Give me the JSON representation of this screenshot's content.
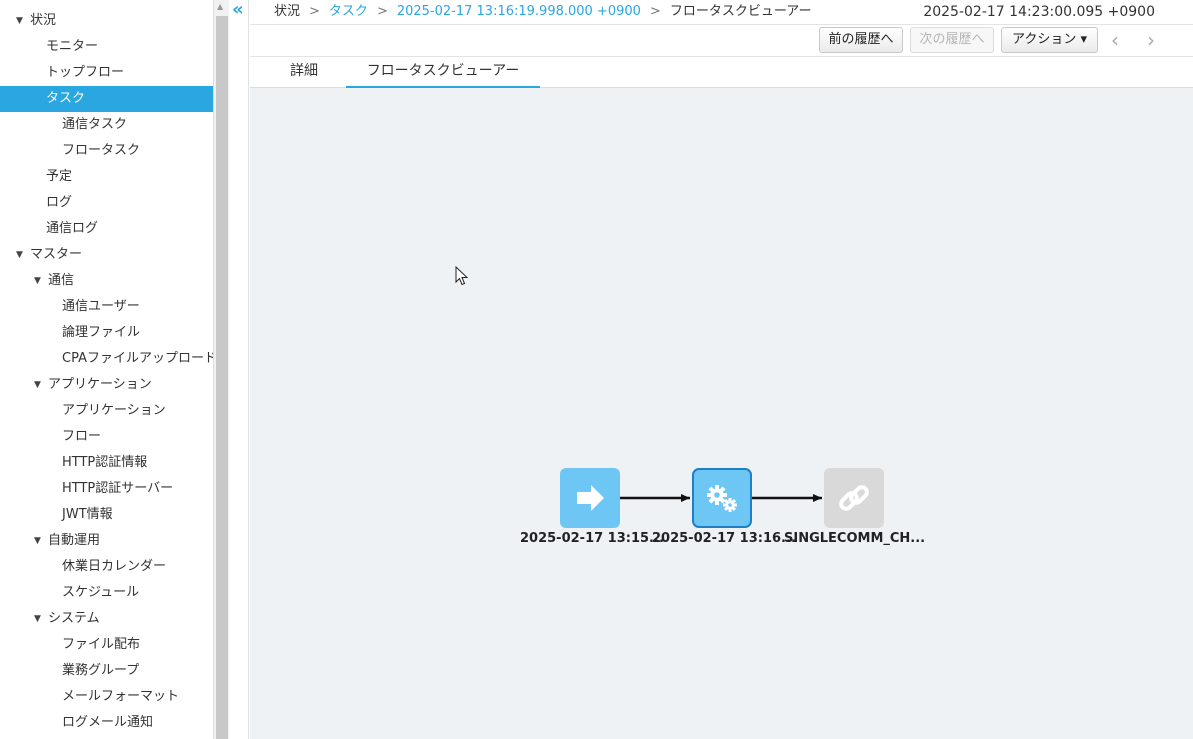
{
  "sidebar": {
    "items": [
      {
        "label": "状況",
        "caret": "▼"
      },
      {
        "label": "モニター"
      },
      {
        "label": "トップフロー"
      },
      {
        "label": "タスク",
        "selected": true
      },
      {
        "label": "通信タスク"
      },
      {
        "label": "フロータスク"
      },
      {
        "label": "予定"
      },
      {
        "label": "ログ"
      },
      {
        "label": "通信ログ"
      },
      {
        "label": "マスター",
        "caret": "▼"
      },
      {
        "label": "通信",
        "caret": "▼"
      },
      {
        "label": "通信ユーザー"
      },
      {
        "label": "論理ファイル"
      },
      {
        "label": "CPAファイルアップロード"
      },
      {
        "label": "アプリケーション",
        "caret": "▼"
      },
      {
        "label": "アプリケーション"
      },
      {
        "label": "フロー"
      },
      {
        "label": "HTTP認証情報"
      },
      {
        "label": "HTTP認証サーバー"
      },
      {
        "label": "JWT情報"
      },
      {
        "label": "自動運用",
        "caret": "▼"
      },
      {
        "label": "休業日カレンダー"
      },
      {
        "label": "スケジュール"
      },
      {
        "label": "システム",
        "caret": "▼"
      },
      {
        "label": "ファイル配布"
      },
      {
        "label": "業務グループ"
      },
      {
        "label": "メールフォーマット"
      },
      {
        "label": "ログメール通知"
      }
    ],
    "collapse_glyph": "«"
  },
  "breadcrumb": {
    "items": [
      "状況",
      "タスク",
      "2025-02-17 13:16:19.998.000 +0900",
      "フロータスクビューアー"
    ],
    "separator": ">"
  },
  "header": {
    "timestamp": "2025-02-17 14:23:00.095 +0900"
  },
  "toolbar": {
    "prev_history": "前の履歴へ",
    "next_history": "次の履歴へ",
    "action": "アクション",
    "action_caret": "▾",
    "prev_arrow": "‹",
    "next_arrow": "›"
  },
  "tabs": [
    {
      "label": "詳細",
      "active": false
    },
    {
      "label": "フロータスクビューアー",
      "active": true
    }
  ],
  "flow": {
    "nodes": [
      {
        "label": "2025-02-17 13:15...",
        "icon": "arrow-right-icon",
        "color": "#6ec6f5",
        "state": "normal"
      },
      {
        "label": "2025-02-17 13:16...",
        "icon": "gears-icon",
        "color": "#6ec6f5",
        "state": "selected"
      },
      {
        "label": "SINGLECOMM_CH...",
        "icon": "link-icon",
        "color": "#d9d9d9",
        "state": "inactive"
      }
    ]
  },
  "colors": {
    "accent": "#2aa6e0",
    "canvas_bg": "#eff2f5"
  }
}
